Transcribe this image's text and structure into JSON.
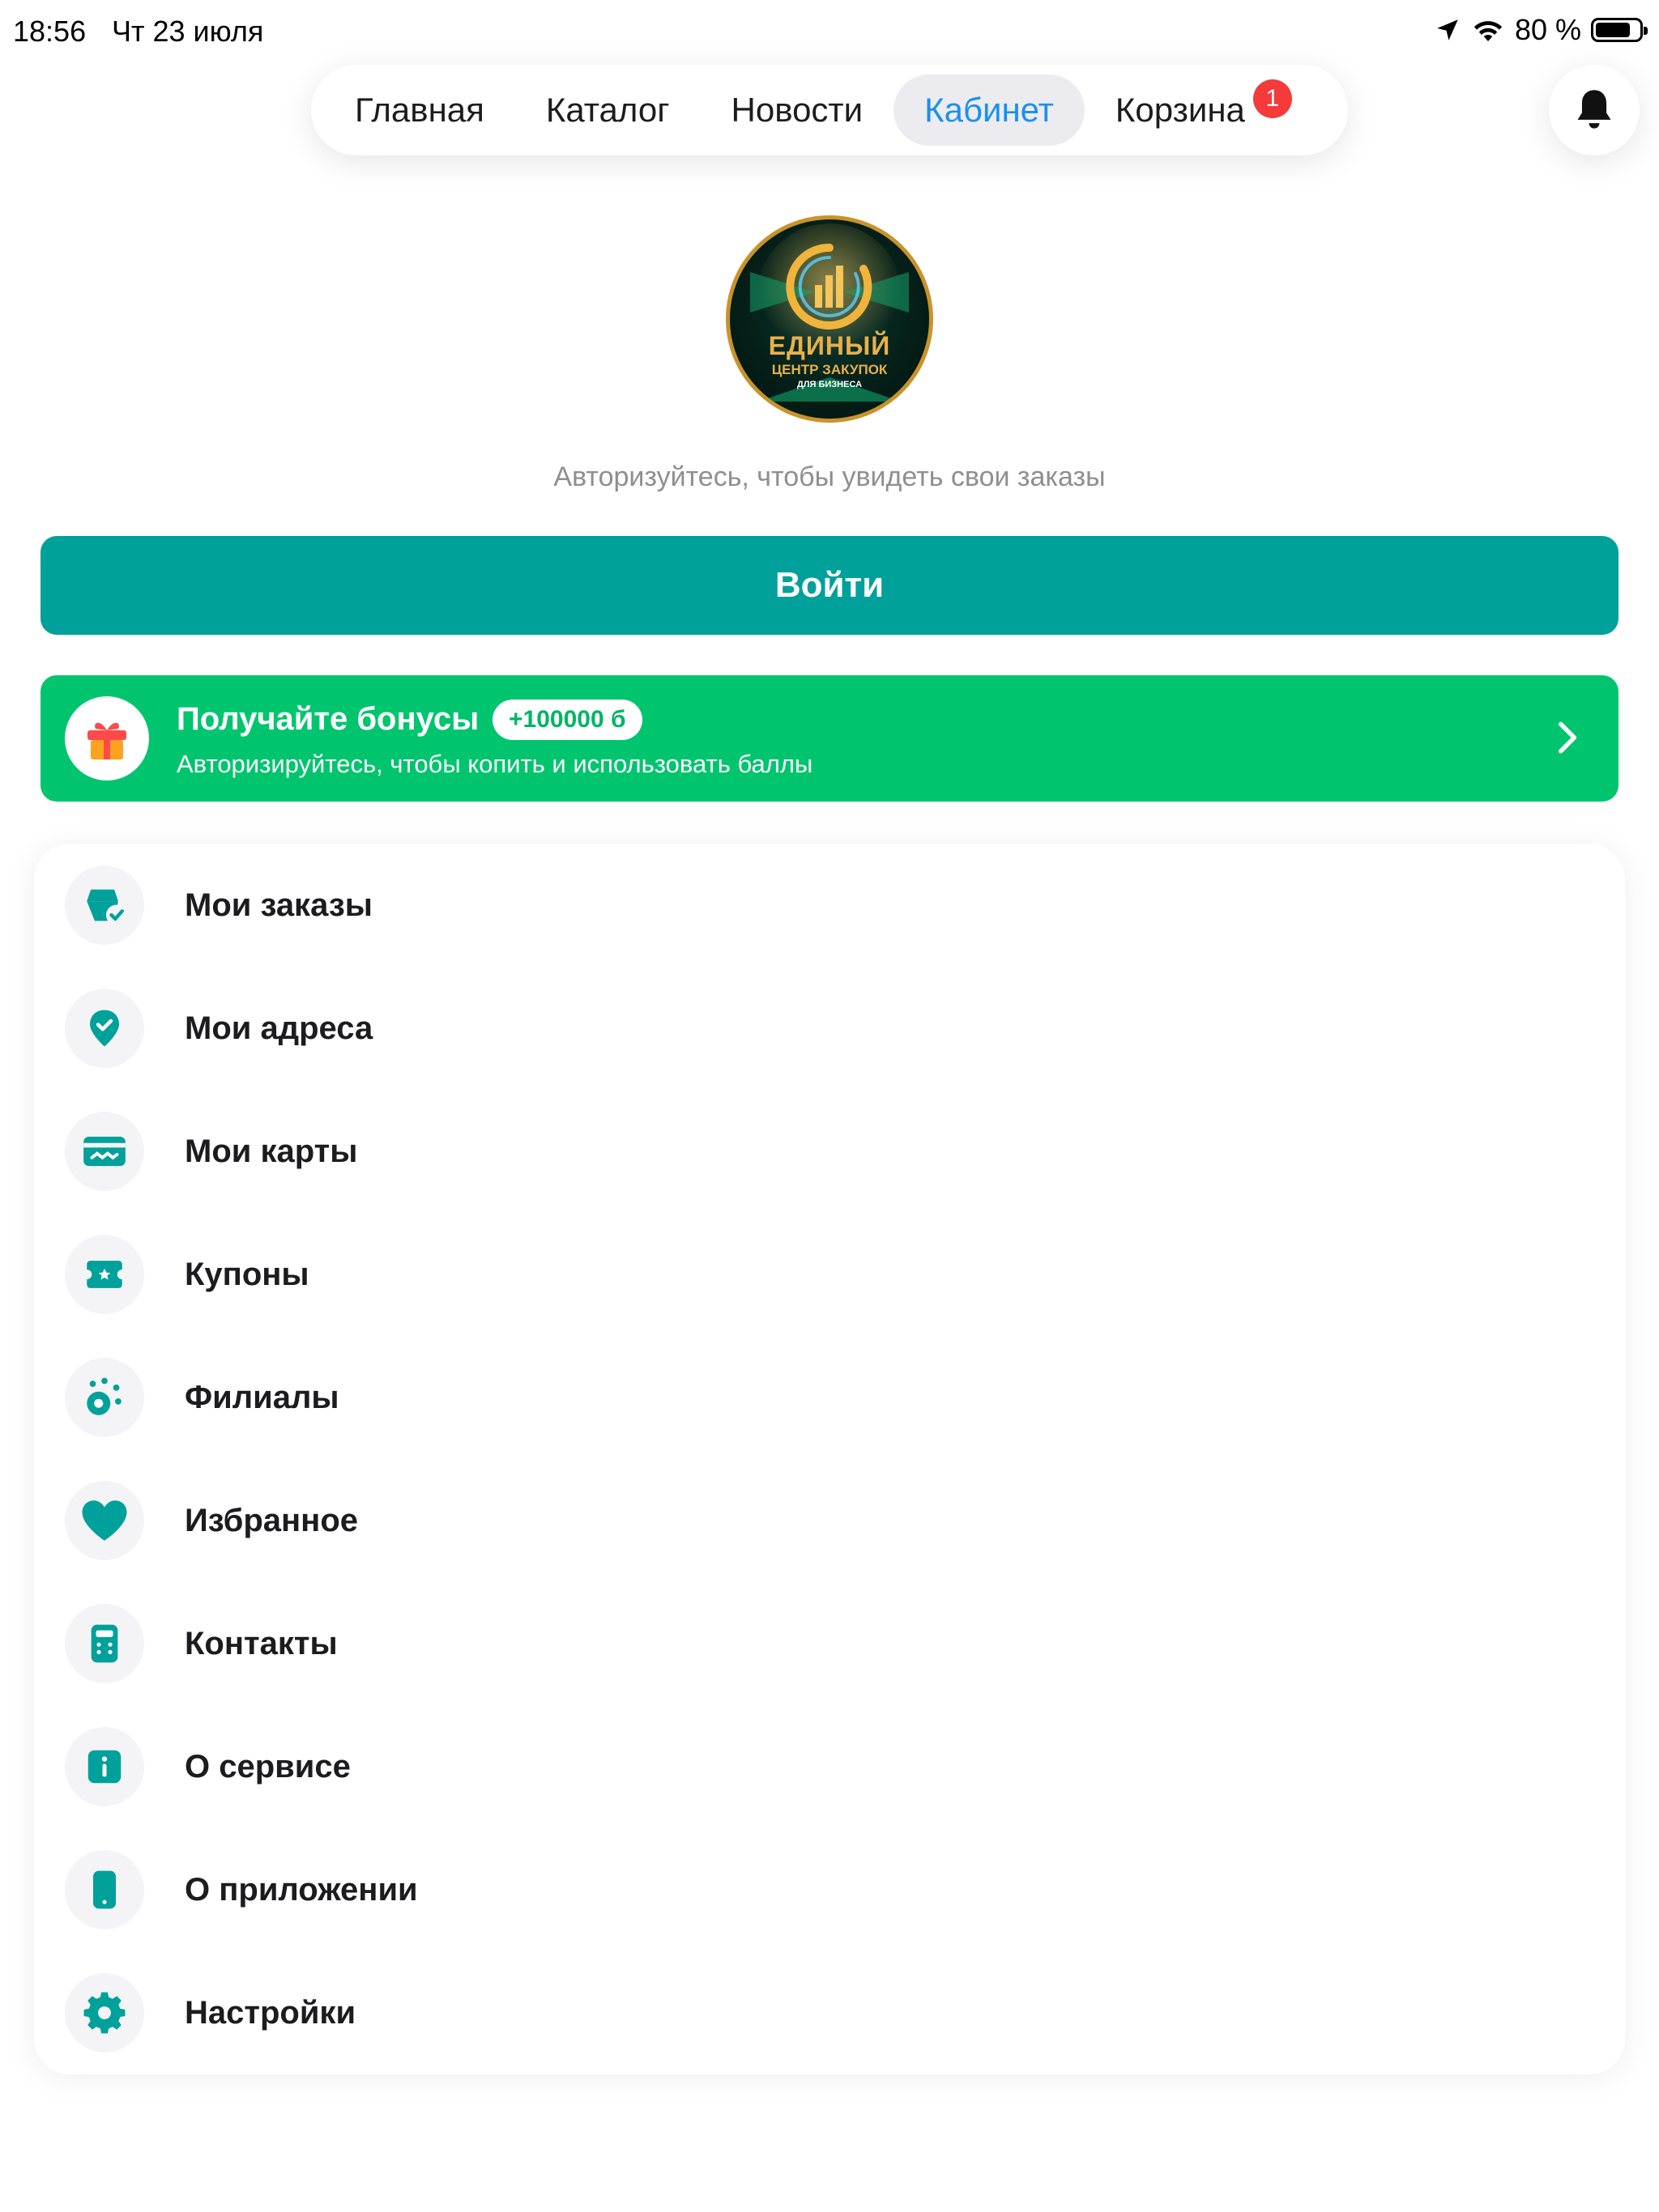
{
  "status_bar": {
    "time": "18:56",
    "date": "Чт 23 июля",
    "battery_text": "80 %",
    "battery_level": 0.8
  },
  "tabs": [
    {
      "label": "Главная"
    },
    {
      "label": "Каталог"
    },
    {
      "label": "Новости"
    },
    {
      "label": "Кабинет"
    },
    {
      "label": "Корзина",
      "badge": "1"
    }
  ],
  "active_tab": "Кабинет",
  "logo": {
    "line1": "ЕДИНЫЙ",
    "line2": "ЦЕНТР ЗАКУПОК",
    "line3": "ДЛЯ БИЗНЕСА"
  },
  "auth_hint": "Авторизуйтесь, чтобы увидеть свои заказы",
  "login_button": "Войти",
  "bonus": {
    "title": "Получайте бонусы",
    "pill": "+100000 б",
    "subtitle": "Авторизируйтесь, чтобы копить и использовать баллы"
  },
  "menu": [
    {
      "label": "Мои заказы",
      "icon": "basket-check-icon"
    },
    {
      "label": "Мои адреса",
      "icon": "location-check-icon"
    },
    {
      "label": "Мои карты",
      "icon": "card-icon"
    },
    {
      "label": "Купоны",
      "icon": "coupon-icon"
    },
    {
      "label": "Филиалы",
      "icon": "branches-icon"
    },
    {
      "label": "Избранное",
      "icon": "heart-icon"
    },
    {
      "label": "Контакты",
      "icon": "phone-book-icon"
    },
    {
      "label": "О сервисе",
      "icon": "info-icon"
    },
    {
      "label": "О приложении",
      "icon": "phone-icon"
    },
    {
      "label": "Настройки",
      "icon": "gear-icon"
    }
  ],
  "colors": {
    "accent_teal": "#00a19a",
    "bonus_green": "#00c56e",
    "active_tab_text": "#1b8ff0",
    "badge_red": "#f43a3a"
  }
}
